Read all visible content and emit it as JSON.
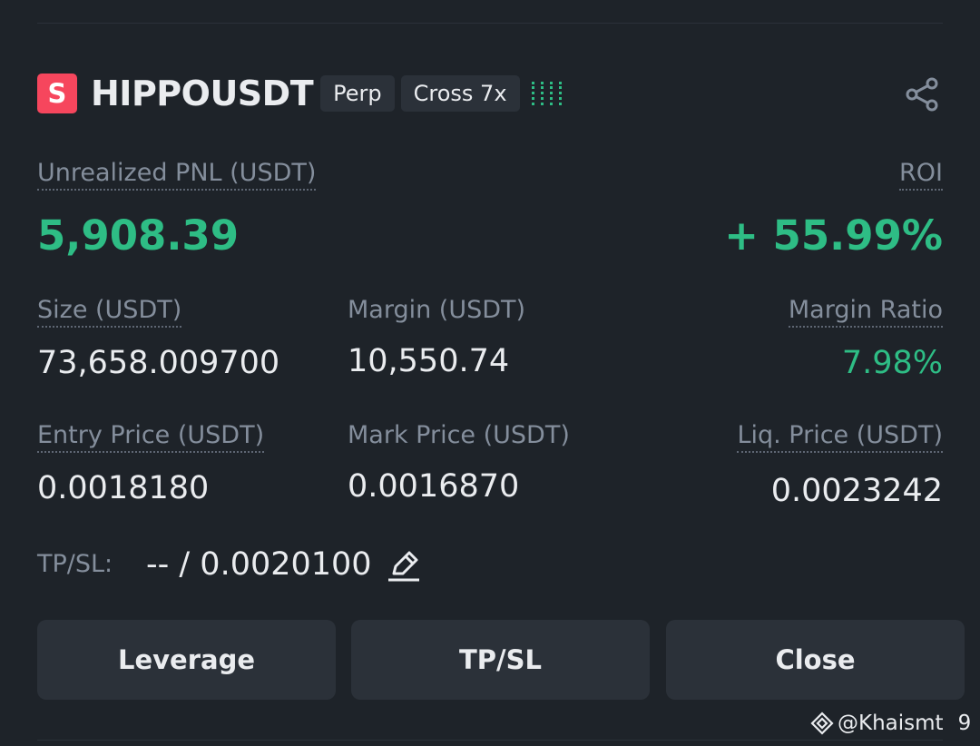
{
  "position": {
    "side_badge": "S",
    "symbol": "HIPPOUSDT",
    "contract_type": "Perp",
    "margin_mode": "Cross 7x",
    "risk_level": "!!!!"
  },
  "pnl": {
    "label": "Unrealized PNL (USDT)",
    "value": "5,908.39",
    "roi_label": "ROI",
    "roi_value": "+ 55.99%"
  },
  "stats_row1": {
    "size_label": "Size (USDT)",
    "size_value": "73,658.009700",
    "margin_label": "Margin (USDT)",
    "margin_value": "10,550.74",
    "margin_ratio_label": "Margin Ratio",
    "margin_ratio_value": "7.98%"
  },
  "stats_row2": {
    "entry_label": "Entry Price (USDT)",
    "entry_value": "0.0018180",
    "mark_label": "Mark Price (USDT)",
    "mark_value": "0.0016870",
    "liq_label": "Liq. Price (USDT)",
    "liq_value": "0.0023242"
  },
  "tpsl": {
    "label": "TP/SL:",
    "value": "-- / 0.0020100"
  },
  "buttons": {
    "leverage": "Leverage",
    "tpsl": "TP/SL",
    "close": "Close"
  },
  "watermark": {
    "handle": "@Khaismt",
    "suffix": "9"
  },
  "colors": {
    "background": "#1e2329",
    "profit_green": "#2ebd85",
    "short_red": "#f6465d",
    "muted_text": "#848e9c",
    "button_bg": "#2b3139"
  },
  "icons": {
    "share": "share-icon",
    "edit": "edit-icon",
    "watermark_logo": "binance-logo-icon"
  }
}
